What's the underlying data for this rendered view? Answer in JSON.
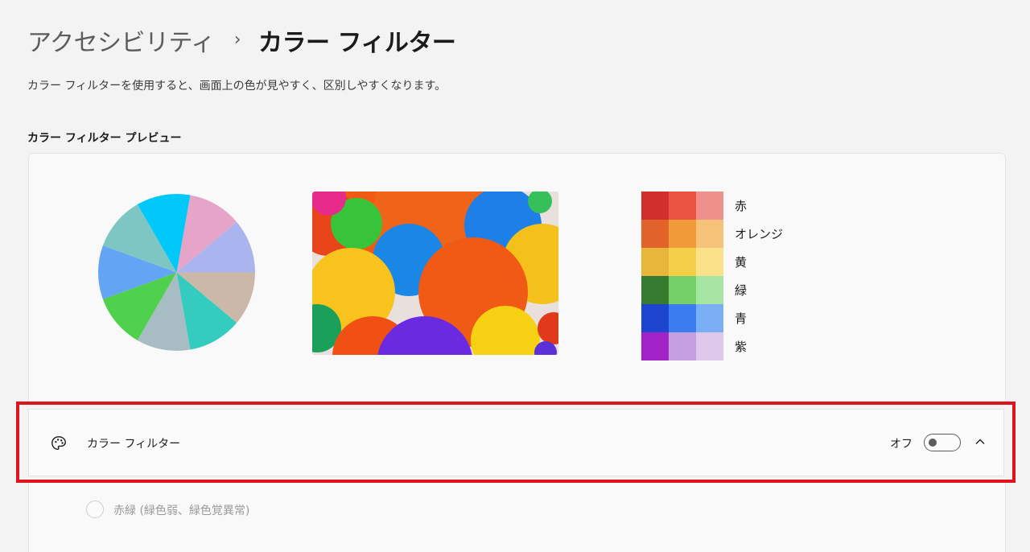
{
  "breadcrumb": {
    "parent": "アクセシビリティ",
    "separator": "›",
    "current": "カラー フィルター"
  },
  "description": "カラー フィルターを使用すると、画面上の色が見やすく、区別しやすくなります。",
  "preview": {
    "title": "カラー フィルター プレビュー",
    "pie_colors": [
      "#e6a5c8",
      "#aab4ee",
      "#ccb8a8",
      "#33ccbf",
      "#a8bcc4",
      "#4fd14e",
      "#64a4f5",
      "#7dc6c4",
      "#00c8f8"
    ],
    "swatches": [
      {
        "label": "赤",
        "colors": [
          "#d12f2e",
          "#e9533f",
          "#ef918a"
        ]
      },
      {
        "label": "オレンジ",
        "colors": [
          "#e2632a",
          "#f09a3a",
          "#f6c278"
        ]
      },
      {
        "label": "黄",
        "colors": [
          "#e9b63c",
          "#f6cf48",
          "#fbe189"
        ]
      },
      {
        "label": "緑",
        "colors": [
          "#357a2e",
          "#76d06a",
          "#a7e5a2"
        ]
      },
      {
        "label": "青",
        "colors": [
          "#1d45d0",
          "#3b7cf0",
          "#7aaef5"
        ]
      },
      {
        "label": "紫",
        "colors": [
          "#a224c9",
          "#c39ee0",
          "#ddc7eb"
        ]
      }
    ]
  },
  "setting": {
    "icon": "palette-icon",
    "label": "カラー フィルター",
    "toggle_state": "オフ",
    "toggle_on": false,
    "expand_icon": "chevron-up-icon",
    "highlight_color": "#e0121c"
  },
  "options": [
    {
      "label": "赤緑 (緑色弱、緑色覚異常)",
      "selected": false,
      "enabled": false
    }
  ]
}
